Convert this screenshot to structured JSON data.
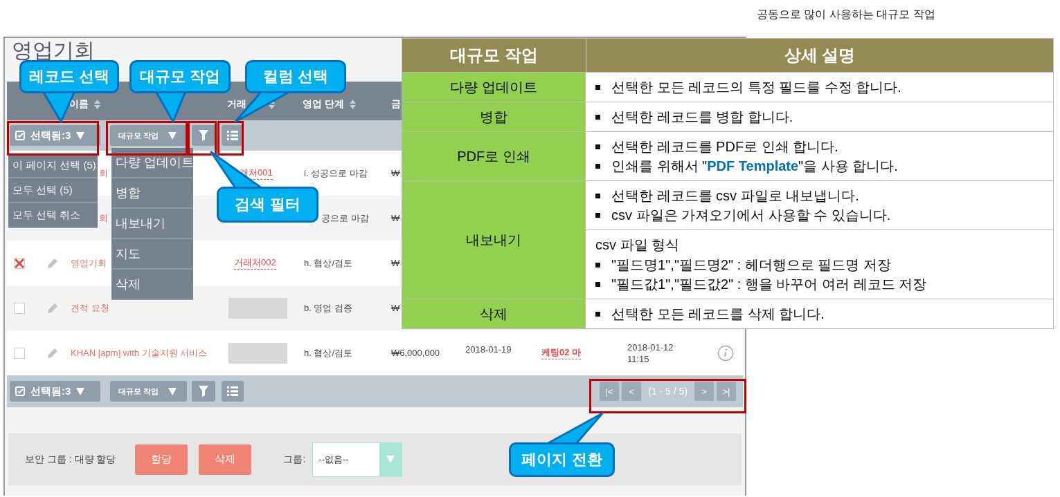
{
  "page_caption": "공동으로 많이 사용하는 대규모 작업",
  "app": {
    "title": "영업기회",
    "columns": [
      {
        "label": "이름"
      },
      {
        "label": "거래"
      },
      {
        "label": "영업 단계"
      },
      {
        "label": "금"
      }
    ],
    "top_toolbar": {
      "selection": "선택됨:3",
      "mass_action": "대규모 작업"
    },
    "selection_menu": [
      "이 페이지 선택 (5)",
      "모두 선택 (5)",
      "모두 선택 취소"
    ],
    "mass_action_menu": [
      "다량 업데이트",
      "병합",
      "내보내기",
      "지도",
      "삭제"
    ],
    "rows": [
      {
        "kind": "partial",
        "name": "회",
        "account": "래처001",
        "stage": "i. 성공으로 마감",
        "amount": "₩"
      },
      {
        "kind": "partial",
        "name": "회",
        "stage": "공으로 마감",
        "amount": "₩"
      },
      {
        "kind": "full",
        "checked": true,
        "name": "영업기회",
        "account": "거래처002",
        "stage": "h. 협상/검토",
        "amount": "₩"
      },
      {
        "kind": "full",
        "checked": false,
        "name": "견적 요청",
        "account_masked": true,
        "stage": "b. 영업 검증",
        "amount": "₩"
      },
      {
        "kind": "full",
        "checked": false,
        "name": "KHAN [apm] with 기술지원 서비스",
        "account_masked": true,
        "stage": "h. 협상/검토",
        "amount": "₩6,000,000",
        "close_date": "2018-01-19",
        "user": "케팅02 마",
        "modified": "2018-01-12 11:15",
        "info": true
      }
    ],
    "bottom_toolbar": {
      "selection": "선택됨:3",
      "mass_action": "대규모 작업",
      "pagination": {
        "first": "|<",
        "prev": "<",
        "range": "(1 - 5 / 5)",
        "next": ">",
        "last": ">|"
      }
    },
    "bulk_panel": {
      "label": "보안 그룹 : 대량 할당",
      "buttons": [
        "할당",
        "삭제"
      ],
      "group_label": "그룹:",
      "group_value": "--없음--"
    }
  },
  "callouts": [
    {
      "text": "레코드 선택"
    },
    {
      "text": "대규모 작업"
    },
    {
      "text": "컬럼 선택"
    },
    {
      "text": "검색 필터"
    },
    {
      "text": "페이지 전환"
    }
  ],
  "guide_table": {
    "headers": [
      "대규모 작업",
      "상세 설명"
    ],
    "rows": [
      {
        "action": "다량 업데이트",
        "blocks": [
          {
            "kind": "bullets",
            "items": [
              "선택한 모든 레코드의 특정 필드를 수정 합니다."
            ]
          }
        ]
      },
      {
        "action": "병합",
        "blocks": [
          {
            "kind": "bullets",
            "items": [
              "선택한 레코드를 병합 합니다."
            ]
          }
        ]
      },
      {
        "action": "PDF로 인쇄",
        "blocks": [
          {
            "kind": "bullets",
            "items": [
              "선택한 레코드를 PDF로 인쇄 합니다.",
              "인쇄를 위해서 \"**PDF Template**\"을 사용 합니다."
            ]
          }
        ]
      },
      {
        "action": "내보내기",
        "blocks": [
          {
            "kind": "bullets",
            "items": [
              "선택한 레코드를 csv 파일로 내보냅니다.",
              "csv 파일은 가져오기에서 사용할 수 있습니다."
            ]
          },
          {
            "kind": "note",
            "heading": "csv 파일 형식",
            "items": [
              "\"필드명1\",\"필드명2\" : 헤더행으로 필드명 저장",
              "\"필드값1\",\"필드값2\" : 행을 바꾸어 여러 레코드 저장"
            ]
          }
        ]
      },
      {
        "action": "삭제",
        "blocks": [
          {
            "kind": "bullets",
            "items": [
              "선택한 모든 레코드를 삭제 합니다."
            ]
          }
        ]
      }
    ]
  }
}
